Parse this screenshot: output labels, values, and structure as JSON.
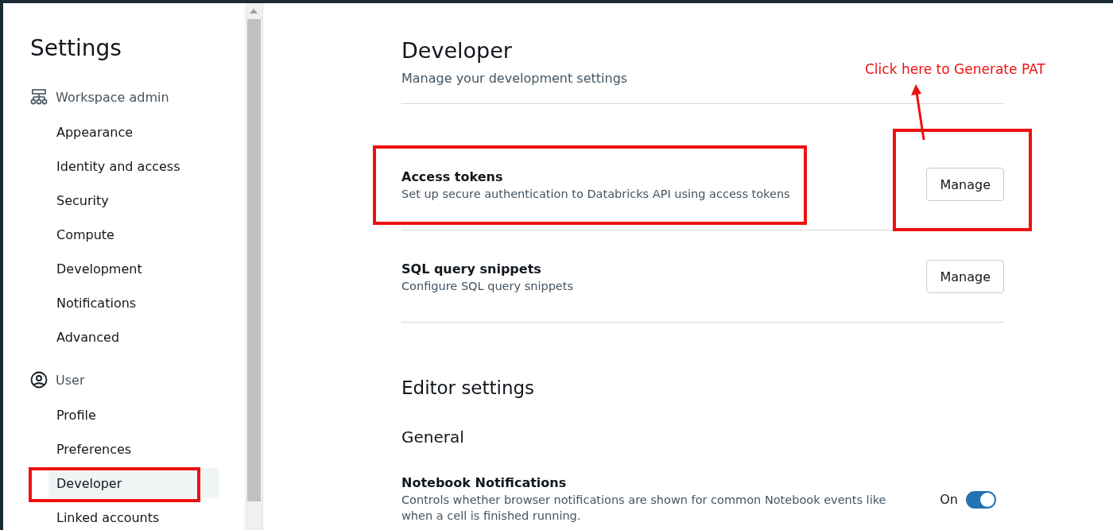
{
  "sidebar": {
    "title": "Settings",
    "groups": [
      {
        "label": "Workspace admin",
        "items": [
          {
            "label": "Appearance",
            "selected": false
          },
          {
            "label": "Identity and access",
            "selected": false
          },
          {
            "label": "Security",
            "selected": false
          },
          {
            "label": "Compute",
            "selected": false
          },
          {
            "label": "Development",
            "selected": false
          },
          {
            "label": "Notifications",
            "selected": false
          },
          {
            "label": "Advanced",
            "selected": false
          }
        ]
      },
      {
        "label": "User",
        "items": [
          {
            "label": "Profile",
            "selected": false
          },
          {
            "label": "Preferences",
            "selected": false
          },
          {
            "label": "Developer",
            "selected": true
          },
          {
            "label": "Linked accounts",
            "selected": false
          }
        ]
      }
    ]
  },
  "main": {
    "title": "Developer",
    "subtitle": "Manage your development settings",
    "rows": [
      {
        "title": "Access tokens",
        "description": "Set up secure authentication to Databricks API using access tokens",
        "button": "Manage"
      },
      {
        "title": "SQL query snippets",
        "description": "Configure SQL query snippets",
        "button": "Manage"
      }
    ],
    "section_title": "Editor settings",
    "subsection_title": "General",
    "settings": [
      {
        "title": "Notebook Notifications",
        "description": "Controls whether browser notifications are shown for common Notebook events like when a cell is finished running.",
        "state_label": "On",
        "on": true
      }
    ]
  },
  "annotation": {
    "text": "Click here to Generate PAT"
  }
}
